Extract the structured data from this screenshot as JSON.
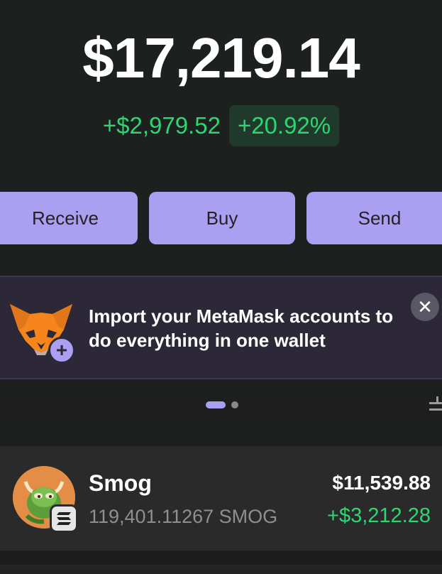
{
  "portfolio": {
    "balance": "$17,219.14",
    "change_abs": "+$2,979.52",
    "change_pct": "+20.92%"
  },
  "actions": {
    "receive_label": "Receive",
    "buy_label": "Buy",
    "send_label": "Send"
  },
  "promo": {
    "icon": "metamask-fox-icon",
    "text": "Import your MetaMask accounts to do everything in one wallet",
    "close_icon": "close-icon"
  },
  "carousel": {
    "pages": 2,
    "active_index": 0
  },
  "tokens": [
    {
      "name": "Smog",
      "amount": "119,401.11267 SMOG",
      "value": "$11,539.88",
      "change": "+$3,212.28",
      "chain_icon": "solana-icon"
    }
  ],
  "colors": {
    "accent": "#ab9ff2",
    "positive": "#2ed573",
    "background": "#1c1f1e",
    "promo_bg": "#2c2838"
  }
}
